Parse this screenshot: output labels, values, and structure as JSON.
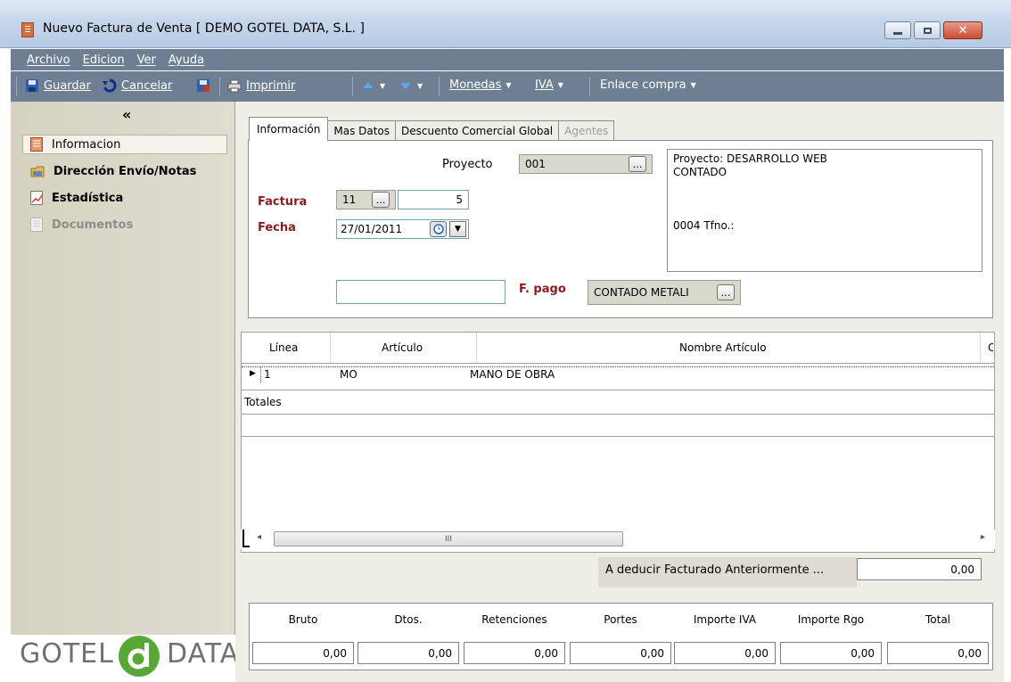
{
  "window": {
    "title": "Nuevo Factura de Venta [ DEMO GOTEL DATA, S.L. ]"
  },
  "menu": [
    "Archivo",
    "Edicion",
    "Ver",
    "Ayuda"
  ],
  "toolbar": {
    "save_label": "Guardar",
    "cancel_label": "Cancelar",
    "print_label": "Imprimir",
    "currencies_label": "Monedas",
    "vat_label": "IVA",
    "purchase_link_label": "Enlace compra"
  },
  "sidebar": {
    "collapse_glyph": "«",
    "items": [
      {
        "label": "Informacion",
        "icon": "document-icon",
        "selected": true
      },
      {
        "label": "Dirección Envío/Notas",
        "icon": "folder-note-icon"
      },
      {
        "label": "Estadística",
        "icon": "chart-icon"
      },
      {
        "label": "Documentos",
        "icon": "document-icon",
        "disabled": true
      }
    ],
    "logo_left": "GOTEL",
    "logo_right": "DATA"
  },
  "tabs": [
    "Información",
    "Mas Datos",
    "Descuento Comercial Global",
    "Agentes"
  ],
  "info": {
    "proyecto_label": "Proyecto",
    "proyecto_value": "001",
    "project_details": [
      "Proyecto: DESARROLLO WEB",
      "CONTADO",
      "",
      "",
      "0004  Tfno.:"
    ],
    "factura_label": "Factura",
    "factura_serie": "11",
    "factura_numero": "5",
    "fecha_label": "Fecha",
    "fecha_value": "27/01/2011",
    "extra_value": "",
    "fpago_label": "F. pago",
    "fpago_value": "CONTADO METALI"
  },
  "grid": {
    "columns": [
      "Línea",
      "Artículo",
      "Nombre Artículo",
      "C"
    ],
    "rows": [
      {
        "linea": "1",
        "articulo": "MO",
        "nombre": "MANO DE OBRA"
      }
    ],
    "totals_label": "Totales",
    "scroll_glyph": "III"
  },
  "deduct": {
    "label": "A deducir Facturado Anteriormente ...",
    "value": "0,00"
  },
  "totals": {
    "headers": [
      "Bruto",
      "Dtos.",
      "Retenciones",
      "Portes",
      "Importe IVA",
      "Importe Rgo",
      "Total"
    ],
    "values": [
      "0,00",
      "0,00",
      "0,00",
      "0,00",
      "0,00",
      "0,00",
      "0,00"
    ]
  },
  "colors": {
    "toolbar_bg": "#6e7e93",
    "label_red": "#8b1c1c",
    "logo_green": "#58a837"
  }
}
